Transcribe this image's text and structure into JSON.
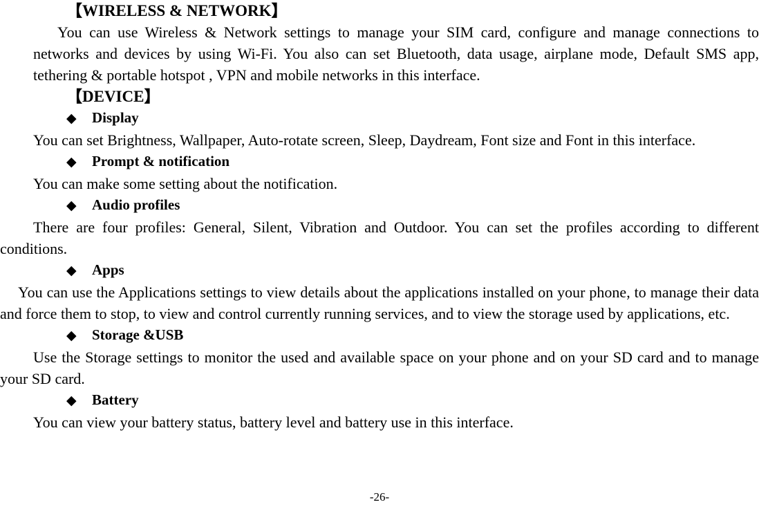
{
  "page": {
    "page_number_label": "-26-"
  },
  "sections": [
    {
      "heading": "【WIRELESS & NETWORK】",
      "paragraph": "You can use Wireless & Network settings to manage your SIM card, configure and manage connections to networks and devices by using Wi-Fi. You also can set Bluetooth, data usage, airplane mode, Default SMS app, tethering & portable hotspot , VPN and mobile networks in this interface."
    },
    {
      "heading": "【DEVICE】"
    }
  ],
  "bullets": [
    {
      "glyph": "◆",
      "glyph_name": "diamond-bullet-icon",
      "label": "Display",
      "paragraph": "You can set Brightness, Wallpaper, Auto-rotate screen, Sleep, Daydream, Font size and Font in this interface."
    },
    {
      "glyph": "◆",
      "glyph_name": "diamond-bullet-icon",
      "label": "Prompt & notification",
      "paragraph": "You can make some setting about the notification."
    },
    {
      "glyph": "◆",
      "glyph_name": "diamond-bullet-icon",
      "label": "Audio profiles",
      "paragraph": "There are four profiles: General, Silent, Vibration and Outdoor. You can set the profiles according to different conditions."
    },
    {
      "glyph": "◆",
      "glyph_name": "diamond-bullet-icon",
      "label": "Apps",
      "paragraph": "You can use the Applications settings to view details about the applications installed on your phone, to manage their data and force them to stop, to view and control currently running services, and to view the storage used by applications, etc."
    },
    {
      "glyph": "◆",
      "glyph_name": "diamond-bullet-icon",
      "label": "Storage &USB",
      "paragraph": "Use the Storage settings to monitor the used and available space on your phone and on your SD card and to manage your SD card."
    },
    {
      "glyph": "◆",
      "glyph_name": "diamond-bullet-icon",
      "label": "Battery",
      "paragraph": "You can view your battery status, battery level and battery use in this interface."
    }
  ]
}
